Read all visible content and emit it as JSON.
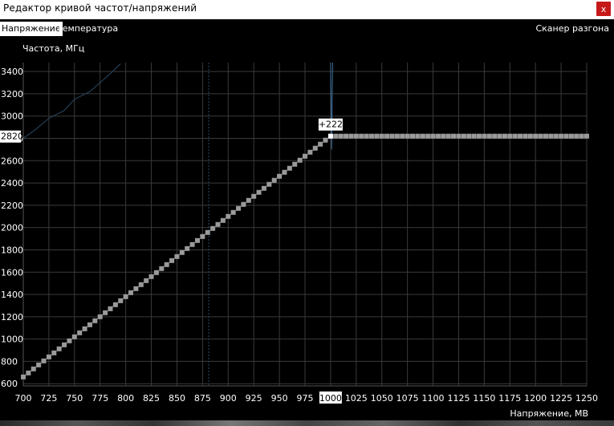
{
  "window": {
    "title": "Редактор кривой частот/напряжений",
    "close_glyph": "x"
  },
  "tabs": {
    "voltage": "Напряжение",
    "temperature": "Температура",
    "scanner": "Сканер разгона"
  },
  "chart_data": {
    "type": "line",
    "ylabel": "Частота, МГц",
    "xlabel": "Напряжение, МВ",
    "xlim": [
      700,
      1250
    ],
    "ylim": [
      580,
      3480
    ],
    "x_ticks": [
      700,
      725,
      750,
      775,
      800,
      825,
      850,
      875,
      900,
      925,
      950,
      975,
      1000,
      1025,
      1050,
      1075,
      1100,
      1125,
      1150,
      1175,
      1200,
      1225,
      1250
    ],
    "y_ticks": [
      600,
      800,
      1000,
      1200,
      1400,
      1600,
      1800,
      2000,
      2200,
      2400,
      2600,
      2800,
      3000,
      3200,
      3400
    ],
    "highlight_x": 1000,
    "highlight_y": 2820,
    "point_label": "+222",
    "marker_x": 881,
    "curve_start": [
      700,
      660
    ],
    "curve_knee": [
      1000,
      2820
    ],
    "curve_end": [
      1250,
      2820
    ],
    "colors": {
      "grid": "#3a3a3a",
      "curve": "#3d6d97",
      "points": "#9a9a9a",
      "highlight": "#ffffff",
      "marker": "#2a4a6a"
    }
  }
}
